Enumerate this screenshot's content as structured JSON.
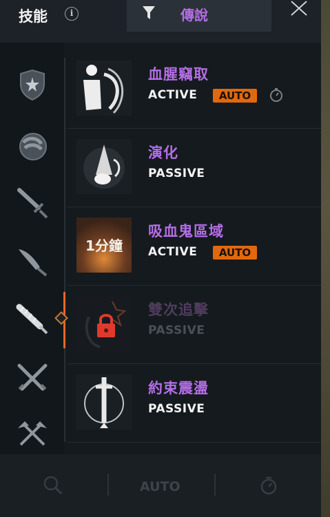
{
  "header": {
    "title": "技能",
    "info_icon": "info-icon",
    "filter_icon": "filter-icon",
    "filter_label": "傳說",
    "close_icon": "close-icon"
  },
  "sidebar": {
    "categories": [
      {
        "icon": "shield-icon",
        "selected": false
      },
      {
        "icon": "gauntlet-icon",
        "selected": false
      },
      {
        "icon": "sword-icon",
        "selected": false
      },
      {
        "icon": "blade-icon",
        "selected": false
      },
      {
        "icon": "spiked-club-icon",
        "selected": true
      },
      {
        "icon": "crossed-swords-icon",
        "selected": false
      },
      {
        "icon": "crossed-axes-icon",
        "selected": false
      }
    ]
  },
  "skills": [
    {
      "name": "血腥竊取",
      "type": "ACTIVE",
      "auto": "AUTO",
      "has_auto": true,
      "has_timer": true,
      "locked": false,
      "thumb_text": ""
    },
    {
      "name": "演化",
      "type": "PASSIVE",
      "auto": "",
      "has_auto": false,
      "has_timer": false,
      "locked": false,
      "thumb_text": ""
    },
    {
      "name": "吸血鬼區域",
      "type": "ACTIVE",
      "auto": "AUTO",
      "has_auto": true,
      "has_timer": false,
      "locked": false,
      "thumb_text": "1分鐘"
    },
    {
      "name": "雙次追擊",
      "type": "PASSIVE",
      "auto": "",
      "has_auto": false,
      "has_timer": false,
      "locked": true,
      "thumb_text": ""
    },
    {
      "name": "約束震盪",
      "type": "PASSIVE",
      "auto": "",
      "has_auto": false,
      "has_timer": false,
      "locked": false,
      "thumb_text": ""
    }
  ],
  "footer": {
    "zoom_icon": "magnify-icon",
    "auto_label": "AUTO",
    "timer_icon": "stopwatch-icon"
  },
  "colors": {
    "accent_purple": "#b46ee6",
    "auto_orange": "#e2680d",
    "active_indicator": "#e8672a",
    "lock_red": "#e03a2e"
  }
}
